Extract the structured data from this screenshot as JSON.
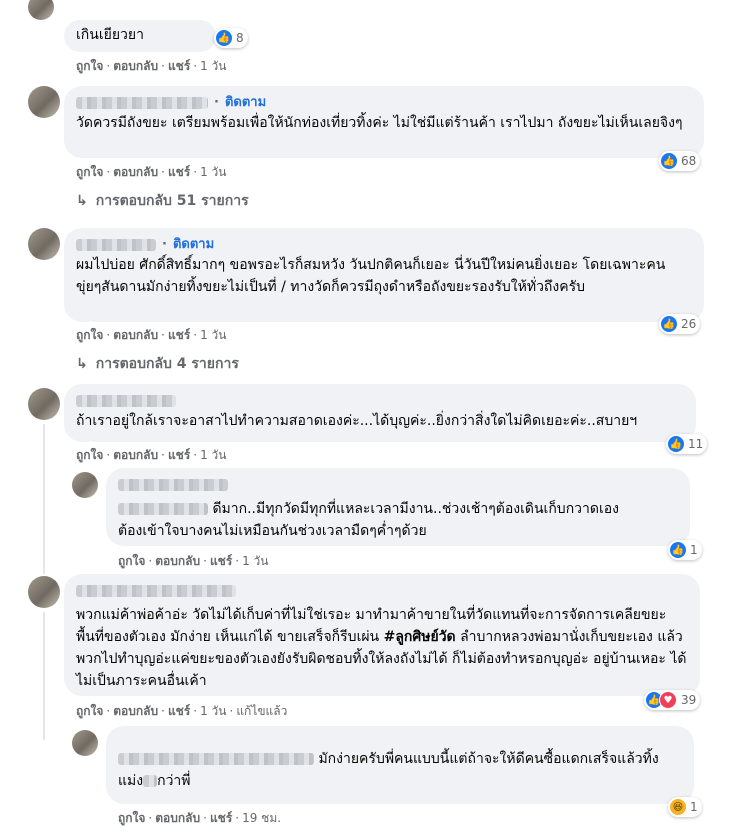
{
  "ui": {
    "like": "ถูกใจ",
    "reply": "ตอบกลับ",
    "share": "แชร์",
    "follow": "ติดตาม",
    "edited": "แก้ไขแล้ว",
    "reply_arrow": "↳"
  },
  "comments": [
    {
      "text": "เกินเยียวยา",
      "reactions": "8",
      "time": "1 วัน"
    },
    {
      "text": "วัดควรมีถังขยะ เตรียมพร้อมเพื่อให้นักท่องเที่ยวทิ้งค่ะ ไม่ใช่มีแต่ร้านค้า เราไปมา ถังขยะไม่เห็นเลยจิงๆ",
      "reactions": "68",
      "time": "1 วัน",
      "replies": "การตอบกลับ 51 รายการ"
    },
    {
      "text": "ผมไปบ่อย ศักดิ์สิทธิ์มากๆ ขอพรอะไรก็สมหวัง วันปกติคนก็เยอะ นี่วันปีใหม่คนยิ่งเยอะ โดยเฉพาะคนขุ่ยๆสันดานมักง่ายทิ้งขยะไม่เป็นที่ / ทางวัดก็ควรมีถุงดำหรือถังขยะรองรับให้ทั่วถึงครับ",
      "reactions": "26",
      "time": "1 วัน",
      "replies": "การตอบกลับ 4 รายการ"
    },
    {
      "text": "ถ้าเราอยู่ใกล้เราจะอาสาไปทำความสอาดเองค่ะ...ได้บุญค่ะ..ยิ่งกว่าสิ่งใดไม่คิดเยอะค่ะ..สบายฯ",
      "reactions": "11",
      "time": "1 วัน"
    },
    {
      "text_a": "ดีมาก..มีทุกวัดมีทุกที่แหละเวลามีงาน..ช่วงเช้าๆต้องเดินเก็บกวาดเอง",
      "text_b": "ต้องเข้าใจบางคนไม่เหมือนกันช่วงเวลามืดๆค่ำๆด้วย",
      "reactions": "1",
      "time": "1 วัน"
    },
    {
      "text": "พวกแม่ค้าพ่อค้าอ่ะ วัดไม่ได้เก็บค่าที่ไม่ใช่เรอะ มาทำมาค้าขายในที่วัดแทนที่จะการจัดการเคลียขยะพื้นที่ของตัวเอง มักง่าย เห็นแก่ได้ ขายเสร็จก็รีบเผ่น",
      "hashtag": "#ลูกศิษย์วัด",
      "text_end": " ลำบากหลวงพ่อมานั่งเก็บขยะเอง แล้วพวกไปทำบุญอ่ะแค่ขยะของตัวเองยังรับผิดชอบทิ้งให้ลงถังไม่ได้ ก็ไม่ต้องทำหรอกบุญอ่ะ อยู่บ้านเหอะ ได้ไม่เป็นภาระคนอื่นเค้า",
      "reactions": "39",
      "time": "1 วัน"
    },
    {
      "text_a": "มักง่ายครับพี่คนแบบนี้แต่ถ้าจะให้ดีคนซื้อแดกเสร็จแล้วทิ้ง",
      "text_b": "แม่ง",
      "text_c": "กว่าพี่",
      "reactions": "1",
      "time": "19 ชม."
    }
  ]
}
